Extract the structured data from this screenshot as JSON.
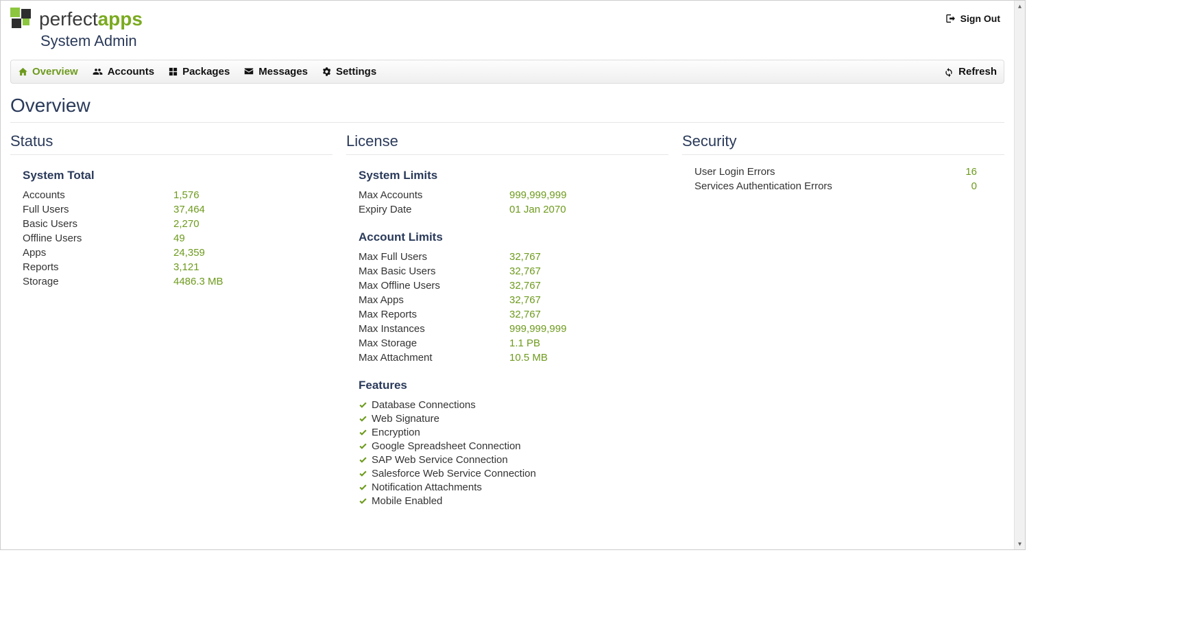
{
  "header": {
    "brand_prefix": "perfect",
    "brand_suffix": "apps",
    "subtitle": "System Admin",
    "signout": "Sign Out"
  },
  "nav": {
    "overview": "Overview",
    "accounts": "Accounts",
    "packages": "Packages",
    "messages": "Messages",
    "settings": "Settings",
    "refresh": "Refresh"
  },
  "page": {
    "title": "Overview"
  },
  "status": {
    "title": "Status",
    "system_total": "System Total",
    "rows": [
      {
        "label": "Accounts",
        "value": "1,576"
      },
      {
        "label": "Full Users",
        "value": "37,464"
      },
      {
        "label": "Basic Users",
        "value": "2,270"
      },
      {
        "label": "Offline Users",
        "value": "49"
      },
      {
        "label": "Apps",
        "value": "24,359"
      },
      {
        "label": "Reports",
        "value": "3,121"
      },
      {
        "label": "Storage",
        "value": "4486.3 MB"
      }
    ]
  },
  "license": {
    "title": "License",
    "system_limits": "System Limits",
    "system_rows": [
      {
        "label": "Max Accounts",
        "value": "999,999,999"
      },
      {
        "label": "Expiry Date",
        "value": "01 Jan 2070"
      }
    ],
    "account_limits": "Account Limits",
    "account_rows": [
      {
        "label": "Max Full Users",
        "value": "32,767"
      },
      {
        "label": "Max Basic Users",
        "value": "32,767"
      },
      {
        "label": "Max Offline Users",
        "value": "32,767"
      },
      {
        "label": "Max Apps",
        "value": "32,767"
      },
      {
        "label": "Max Reports",
        "value": "32,767"
      },
      {
        "label": "Max Instances",
        "value": "999,999,999"
      },
      {
        "label": "Max Storage",
        "value": "1.1 PB"
      },
      {
        "label": "Max Attachment",
        "value": "10.5 MB"
      }
    ],
    "features_title": "Features",
    "features": [
      "Database Connections",
      "Web Signature",
      "Encryption",
      "Google Spreadsheet Connection",
      "SAP Web Service Connection",
      "Salesforce Web Service Connection",
      "Notification Attachments",
      "Mobile Enabled"
    ]
  },
  "security": {
    "title": "Security",
    "rows": [
      {
        "label": "User Login Errors",
        "value": "16"
      },
      {
        "label": "Services Authentication Errors",
        "value": "0"
      }
    ]
  }
}
